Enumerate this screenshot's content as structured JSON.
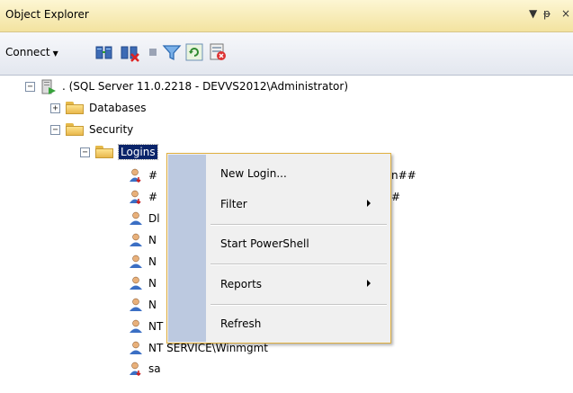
{
  "panel": {
    "title": "Object Explorer",
    "controls": [
      "▼",
      "ᵽ",
      "×"
    ]
  },
  "toolbar": {
    "connect_label": "Connect",
    "connect_arrow": "▼",
    "icons": [
      "connect-server-icon",
      "disconnect-icon",
      "stop-icon",
      "filter-icon",
      "refresh-icon",
      "activity-monitor-icon"
    ]
  },
  "tree": {
    "server": ". (SQL Server 11.0.2218 - DEVVS2012\\Administrator)",
    "databases": "Databases",
    "security": "Security",
    "logins": "Logins",
    "login_items": [
      "#",
      "#",
      "Dl",
      "N",
      "N",
      "N",
      "N",
      "NT",
      "NT SERVICE\\Winmgmt",
      "sa"
    ],
    "login_tails": [
      "n##",
      "#"
    ]
  },
  "context_menu": {
    "items": [
      {
        "label": "New Login...",
        "submenu": false
      },
      {
        "label": "Filter",
        "submenu": true
      },
      {
        "label": "Start PowerShell",
        "submenu": false
      },
      {
        "label": "Reports",
        "submenu": true
      },
      {
        "label": "Refresh",
        "submenu": false
      }
    ]
  },
  "colors": {
    "title_bg": "#f3e3a0",
    "selection": "#0a246a",
    "menu_border": "#e0b040",
    "menu_gutter": "#bcc9e0"
  }
}
